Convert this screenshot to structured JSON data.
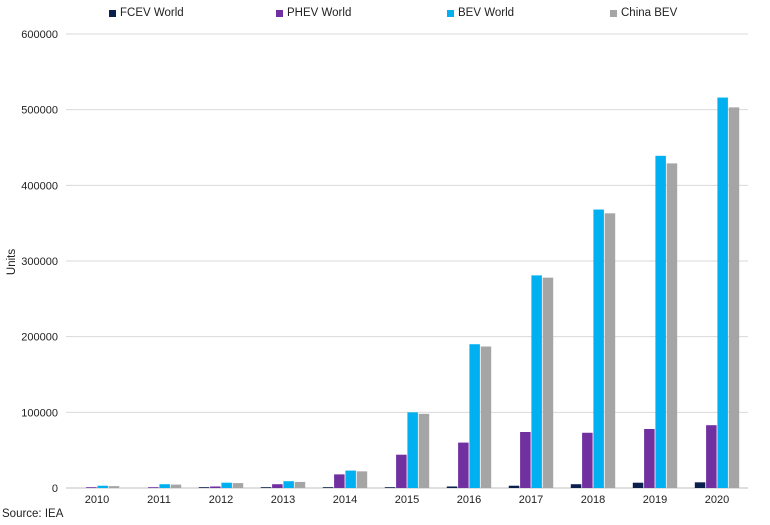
{
  "chart_data": {
    "type": "bar",
    "title": "",
    "xlabel": "",
    "ylabel": "Units",
    "ylim": [
      0,
      600000
    ],
    "yticks": [
      0,
      100000,
      200000,
      300000,
      400000,
      500000,
      600000
    ],
    "ytick_labels": [
      "0",
      "100000",
      "200000",
      "300000",
      "400000",
      "500000",
      "600000"
    ],
    "grid": true,
    "legend_position": "top",
    "categories": [
      "2010",
      "2011",
      "2012",
      "2013",
      "2014",
      "2015",
      "2016",
      "2017",
      "2018",
      "2019",
      "2020"
    ],
    "series": [
      {
        "name": "FCEV World",
        "color": "#0b1f4d",
        "values": [
          0,
          0,
          100,
          200,
          400,
          900,
          2000,
          3000,
          5000,
          7000,
          7500
        ]
      },
      {
        "name": "PHEV World",
        "color": "#7030a0",
        "values": [
          500,
          1000,
          2000,
          5000,
          18000,
          44000,
          60000,
          74000,
          73000,
          78000,
          83000
        ]
      },
      {
        "name": "BEV World",
        "color": "#00b0f0",
        "values": [
          3000,
          5000,
          7000,
          9000,
          23000,
          100000,
          190000,
          281000,
          368000,
          439000,
          516000
        ]
      },
      {
        "name": "China BEV",
        "color": "#a5a5a5",
        "values": [
          2500,
          4500,
          6500,
          8000,
          22000,
          98000,
          187000,
          278000,
          363000,
          429000,
          503000
        ]
      }
    ]
  },
  "source_text": "Source: IEA"
}
